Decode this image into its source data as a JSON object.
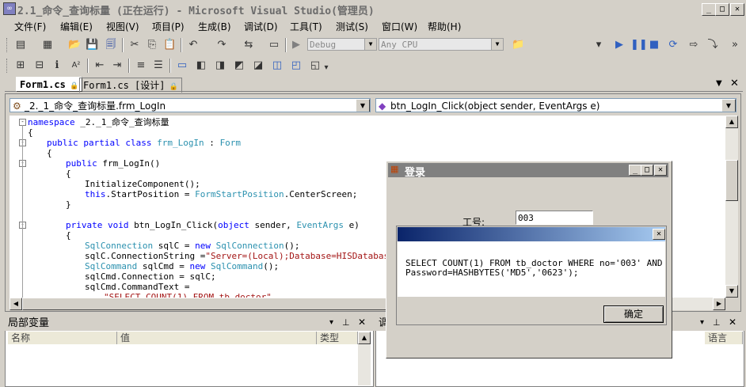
{
  "window": {
    "title": "2.1_命令_查询标量 (正在运行) - Microsoft Visual Studio(管理员)",
    "min": "_",
    "max": "□",
    "close": "✕"
  },
  "menu": [
    "文件(F)",
    "编辑(E)",
    "视图(V)",
    "项目(P)",
    "生成(B)",
    "调试(D)",
    "工具(T)",
    "测试(S)",
    "窗口(W)",
    "帮助(H)"
  ],
  "toolbar": {
    "config": "Debug",
    "platform": "Any CPU"
  },
  "tabs": [
    {
      "label": "Form1.cs"
    },
    {
      "label": "Form1.cs [设计]"
    }
  ],
  "nav": {
    "type_combo": "_2._1_命令_查询标量.frm_LogIn",
    "member_combo": "btn_LogIn_Click(object sender, EventArgs e)"
  },
  "code": [
    {
      "fold": "-",
      "indent": 0,
      "parts": [
        [
          "kw",
          "namespace"
        ],
        [
          "",
          " _2._1_命令_查询标量"
        ]
      ]
    },
    {
      "fold": "",
      "indent": 0,
      "parts": [
        [
          "",
          "{"
        ]
      ]
    },
    {
      "fold": "-",
      "indent": 1,
      "parts": [
        [
          "kw",
          "public partial class"
        ],
        [
          "",
          " "
        ],
        [
          "ty",
          "frm_LogIn"
        ],
        [
          "",
          " : "
        ],
        [
          "ty",
          "Form"
        ]
      ]
    },
    {
      "fold": "",
      "indent": 1,
      "parts": [
        [
          "",
          "{"
        ]
      ]
    },
    {
      "fold": "-",
      "indent": 2,
      "parts": [
        [
          "kw",
          "public"
        ],
        [
          "",
          " frm_LogIn()"
        ]
      ]
    },
    {
      "fold": "",
      "indent": 2,
      "parts": [
        [
          "",
          "{"
        ]
      ]
    },
    {
      "fold": "",
      "indent": 3,
      "parts": [
        [
          "",
          "InitializeComponent();"
        ]
      ]
    },
    {
      "fold": "",
      "indent": 3,
      "parts": [
        [
          "kw",
          "this"
        ],
        [
          "",
          ".StartPosition = "
        ],
        [
          "ty",
          "FormStartPosition"
        ],
        [
          "",
          ".CenterScreen;"
        ]
      ]
    },
    {
      "fold": "",
      "indent": 2,
      "parts": [
        [
          "",
          "}"
        ]
      ]
    },
    {
      "fold": "",
      "indent": 0,
      "parts": [
        [
          "",
          ""
        ]
      ]
    },
    {
      "fold": "-",
      "indent": 2,
      "parts": [
        [
          "kw",
          "private void"
        ],
        [
          "",
          " btn_LogIn_Click("
        ],
        [
          "kw",
          "object"
        ],
        [
          "",
          " sender, "
        ],
        [
          "ty",
          "EventArgs"
        ],
        [
          "",
          " e)"
        ]
      ]
    },
    {
      "fold": "",
      "indent": 2,
      "parts": [
        [
          "",
          "{"
        ]
      ]
    },
    {
      "fold": "",
      "indent": 3,
      "parts": [
        [
          "ty",
          "SqlConnection"
        ],
        [
          "",
          " sqlC = "
        ],
        [
          "kw",
          "new"
        ],
        [
          "",
          " "
        ],
        [
          "ty",
          "SqlConnection"
        ],
        [
          "",
          "();"
        ]
      ]
    },
    {
      "fold": "",
      "indent": 3,
      "parts": [
        [
          "",
          "sqlC.ConnectionString ="
        ],
        [
          "st",
          "\"Server=(Local);Database=HISDatabase;uid="
        ]
      ]
    },
    {
      "fold": "",
      "indent": 3,
      "parts": [
        [
          "ty",
          "SqlCommand"
        ],
        [
          "",
          " sqlCmd = "
        ],
        [
          "kw",
          "new"
        ],
        [
          "",
          " "
        ],
        [
          "ty",
          "SqlCommand"
        ],
        [
          "",
          "();"
        ]
      ]
    },
    {
      "fold": "",
      "indent": 3,
      "parts": [
        [
          "",
          "sqlCmd.Connection = sqlC;"
        ]
      ]
    },
    {
      "fold": "",
      "indent": 3,
      "parts": [
        [
          "",
          "sqlCmd.CommandText ="
        ]
      ]
    },
    {
      "fold": "",
      "indent": 4,
      "parts": [
        [
          "st",
          "\"SELECT COUNT(1) FROM tb_doctor\""
        ]
      ]
    }
  ],
  "locals_panel": {
    "title": "局部变量",
    "columns": [
      "名称",
      "值",
      "类型"
    ]
  },
  "right_panel": {
    "title": "调",
    "column": "语言"
  },
  "login_form": {
    "title": "登录",
    "label": "工号:",
    "value": "003"
  },
  "messagebox": {
    "line1": "SELECT COUNT(1) FROM tb_doctor WHERE no='003' AND",
    "line2": "Password=HASHBYTES('MD5','0623');",
    "ok": "确定"
  }
}
